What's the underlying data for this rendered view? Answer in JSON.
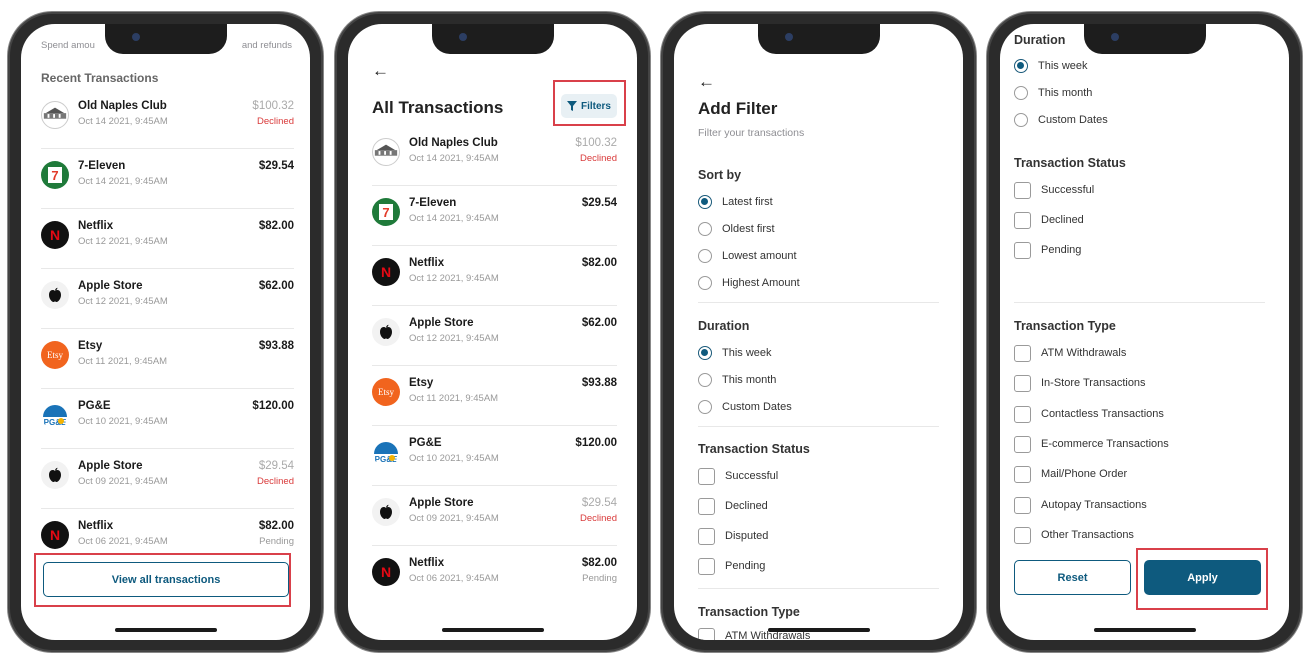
{
  "colors": {
    "accent": "#0e5a7e",
    "declined": "#d93a3a",
    "highlight": "#d9404a"
  },
  "phone1": {
    "top_text_left": "Spend amou",
    "top_text_right": "and refunds",
    "section_title": "Recent Transactions",
    "transactions": [
      {
        "logo": "old-naples-logo",
        "name": "Old Naples Club",
        "date": "Oct 14 2021, 9:45AM",
        "amount": "$100.32",
        "status": "Declined",
        "amount_style": "grey",
        "status_style": "red"
      },
      {
        "logo": "7eleven-logo",
        "name": "7-Eleven",
        "date": "Oct 14 2021, 9:45AM",
        "amount": "$29.54",
        "status": "",
        "amount_style": "bold",
        "status_style": ""
      },
      {
        "logo": "netflix-logo",
        "name": "Netflix",
        "date": "Oct 12 2021, 9:45AM",
        "amount": "$82.00",
        "status": "",
        "amount_style": "bold",
        "status_style": ""
      },
      {
        "logo": "apple-logo",
        "name": "Apple Store",
        "date": "Oct 12 2021, 9:45AM",
        "amount": "$62.00",
        "status": "",
        "amount_style": "bold",
        "status_style": ""
      },
      {
        "logo": "etsy-logo",
        "name": "Etsy",
        "date": "Oct 11 2021, 9:45AM",
        "amount": "$93.88",
        "status": "",
        "amount_style": "bold",
        "status_style": ""
      },
      {
        "logo": "pge-logo",
        "name": "PG&E",
        "date": "Oct 10 2021, 9:45AM",
        "amount": "$120.00",
        "status": "",
        "amount_style": "bold",
        "status_style": ""
      },
      {
        "logo": "apple-logo",
        "name": "Apple Store",
        "date": "Oct 09 2021, 9:45AM",
        "amount": "$29.54",
        "status": "Declined",
        "amount_style": "grey",
        "status_style": "red"
      },
      {
        "logo": "netflix-logo",
        "name": "Netflix",
        "date": "Oct 06 2021, 9:45AM",
        "amount": "$82.00",
        "status": "Pending",
        "amount_style": "bold",
        "status_style": "grey"
      }
    ],
    "view_all_label": "View all transactions"
  },
  "phone2": {
    "back_icon": "arrow-left-icon",
    "title": "All Transactions",
    "filters_label": "Filters",
    "filter_icon": "funnel-icon",
    "transactions": [
      {
        "logo": "old-naples-logo",
        "name": "Old Naples Club",
        "date": "Oct 14 2021, 9:45AM",
        "amount": "$100.32",
        "status": "Declined",
        "amount_style": "grey",
        "status_style": "red"
      },
      {
        "logo": "7eleven-logo",
        "name": "7-Eleven",
        "date": "Oct 14 2021, 9:45AM",
        "amount": "$29.54",
        "status": "",
        "amount_style": "bold",
        "status_style": ""
      },
      {
        "logo": "netflix-logo",
        "name": "Netflix",
        "date": "Oct 12 2021, 9:45AM",
        "amount": "$82.00",
        "status": "",
        "amount_style": "bold",
        "status_style": ""
      },
      {
        "logo": "apple-logo",
        "name": "Apple Store",
        "date": "Oct 12 2021, 9:45AM",
        "amount": "$62.00",
        "status": "",
        "amount_style": "bold",
        "status_style": ""
      },
      {
        "logo": "etsy-logo",
        "name": "Etsy",
        "date": "Oct 11 2021, 9:45AM",
        "amount": "$93.88",
        "status": "",
        "amount_style": "bold",
        "status_style": ""
      },
      {
        "logo": "pge-logo",
        "name": "PG&E",
        "date": "Oct 10 2021, 9:45AM",
        "amount": "$120.00",
        "status": "",
        "amount_style": "bold",
        "status_style": ""
      },
      {
        "logo": "apple-logo",
        "name": "Apple Store",
        "date": "Oct 09 2021, 9:45AM",
        "amount": "$29.54",
        "status": "Declined",
        "amount_style": "grey",
        "status_style": "red"
      },
      {
        "logo": "netflix-logo",
        "name": "Netflix",
        "date": "Oct 06 2021, 9:45AM",
        "amount": "$82.00",
        "status": "Pending",
        "amount_style": "bold",
        "status_style": "grey"
      }
    ]
  },
  "phone3": {
    "back_icon": "arrow-left-icon",
    "title": "Add Filter",
    "subtitle": "Filter your transactions",
    "sort_title": "Sort by",
    "sort_options": [
      {
        "label": "Latest first",
        "selected": true
      },
      {
        "label": "Oldest first",
        "selected": false
      },
      {
        "label": "Lowest amount",
        "selected": false
      },
      {
        "label": "Highest Amount",
        "selected": false
      }
    ],
    "duration_title": "Duration",
    "duration_options": [
      {
        "label": "This week",
        "selected": true
      },
      {
        "label": "This month",
        "selected": false
      },
      {
        "label": "Custom Dates",
        "selected": false
      }
    ],
    "status_title": "Transaction Status",
    "status_options": [
      "Successful",
      "Declined",
      "Disputed",
      "Pending"
    ],
    "type_title": "Transaction Type",
    "type_first": "ATM Withdrawals"
  },
  "phone4": {
    "duration_title": "Duration",
    "duration_options": [
      {
        "label": "This week",
        "selected": true
      },
      {
        "label": "This month",
        "selected": false
      },
      {
        "label": "Custom Dates",
        "selected": false
      }
    ],
    "status_title": "Transaction Status",
    "status_options": [
      "Successful",
      "Declined",
      "Pending"
    ],
    "type_title": "Transaction Type",
    "type_options": [
      "ATM Withdrawals",
      "In-Store Transactions",
      "Contactless Transactions",
      "E-commerce Transactions",
      "Mail/Phone Order",
      "Autopay Transactions",
      "Other Transactions"
    ],
    "reset_label": "Reset",
    "apply_label": "Apply"
  }
}
